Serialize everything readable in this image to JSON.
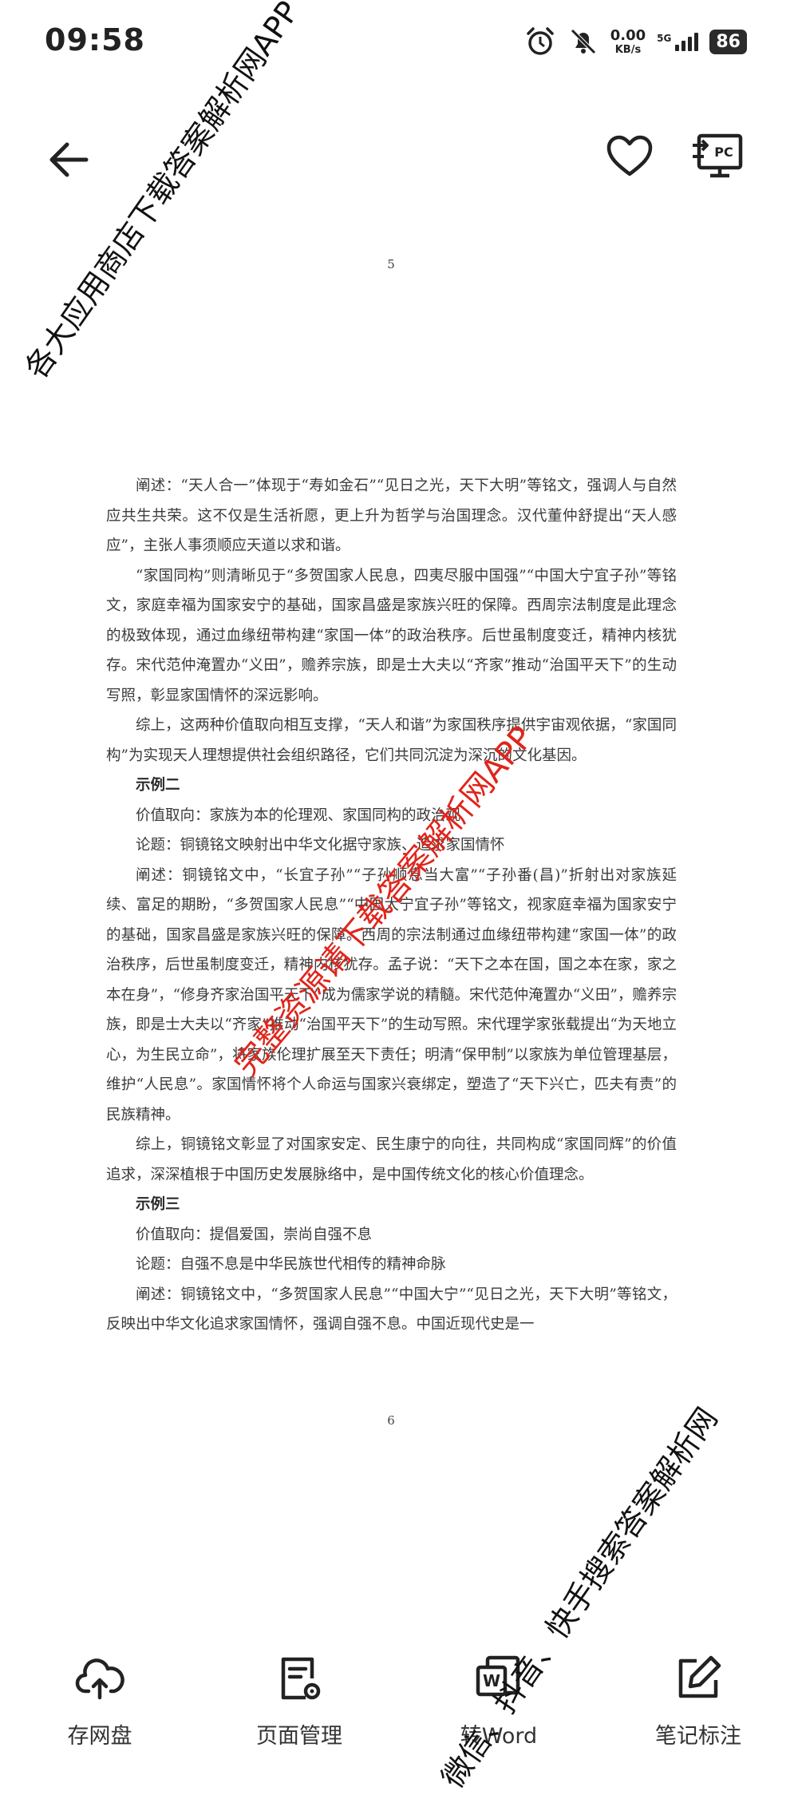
{
  "status_bar": {
    "time": "09:58",
    "net_speed_value": "0.00",
    "net_speed_unit": "KB/s",
    "network": "5G",
    "battery": "86"
  },
  "nav": {
    "back_icon": "arrow-left-icon",
    "favorite_icon": "heart-icon",
    "pc_icon": "cast-to-pc-icon",
    "pc_label": "PC"
  },
  "document": {
    "page_number_top": "5",
    "page_number_bottom": "6",
    "paragraphs": [
      {
        "type": "indent",
        "text": "阐述：“天人合一”体现于“寿如金石”“见日之光，天下大明”等铭文，强调人与自然应共生共荣。这不仅是生活祈愿，更上升为哲学与治国理念。汉代董仲舒提出“天人感应”，主张人事须顺应天道以求和谐。"
      },
      {
        "type": "indent",
        "text": "“家国同构”则清晰见于“多贺国家人民息，四夷尽服中国强”“中国大宁宜子孙”等铭文，家庭幸福为国家安宁的基础，国家昌盛是家族兴旺的保障。西周宗法制度是此理念的极致体现，通过血缘纽带构建“家国一体”的政治秩序。后世虽制度变迁，精神内核犹存。宋代范仲淹置办“义田”，赡养宗族，即是士大夫以“齐家”推动“治国平天下”的生动写照，彰显家国情怀的深远影响。"
      },
      {
        "type": "indent",
        "text": "综上，这两种价值取向相互支撑，“天人和谐”为家国秩序提供宇宙观依据，“家国同构”为实现天人理想提供社会组织路径，它们共同沉淀为深沉的文化基因。"
      },
      {
        "type": "heading",
        "text": "示例二"
      },
      {
        "type": "indent",
        "text": "价值取向：家族为本的伦理观、家国同构的政治观"
      },
      {
        "type": "indent",
        "text": "论题：铜镜铭文映射出中华文化据守家族、追求家国情怀"
      },
      {
        "type": "indent",
        "text": "阐述：铜镜铭文中，“长宜子孙”“子孙顺息当大富”“子孙番(昌)”折射出对家族延续、富足的期盼，“多贺国家人民息”“中国大宁宜子孙”等铭文，视家庭幸福为国家安宁的基础，国家昌盛是家族兴旺的保障。西周的宗法制通过血缘纽带构建“家国一体”的政治秩序，后世虽制度变迁，精神内核犹存。孟子说：“天下之本在国，国之本在家，家之本在身”，“修身齐家治国平天下”成为儒家学说的精髓。宋代范仲淹置办“义田”，赡养宗族，即是士大夫以“齐家”推动“治国平天下”的生动写照。宋代理学家张载提出“为天地立心，为生民立命”，将家族伦理扩展至天下责任；明清“保甲制”以家族为单位管理基层，维护“人民息”。家国情怀将个人命运与国家兴衰绑定，塑造了“天下兴亡，匹夫有责”的民族精神。"
      },
      {
        "type": "indent",
        "text": "综上，铜镜铭文彰显了对国家安定、民生康宁的向往，共同构成“家国同辉”的价值追求，深深植根于中国历史发展脉络中，是中国传统文化的核心价值理念。"
      },
      {
        "type": "heading",
        "text": "示例三"
      },
      {
        "type": "indent",
        "text": "价值取向：提倡爱国，崇尚自强不息"
      },
      {
        "type": "indent",
        "text": "论题：自强不息是中华民族世代相传的精神命脉"
      },
      {
        "type": "indent",
        "text": "阐述：铜镜铭文中，“多贺国家人民息”“中国大宁”“见日之光，天下大明”等铭文，反映出中华文化追求家国情怀，强调自强不息。中国近现代史是一"
      }
    ]
  },
  "toolbar": {
    "items": [
      {
        "icon": "cloud-upload-icon",
        "label": "存网盘"
      },
      {
        "icon": "page-settings-icon",
        "label": "页面管理"
      },
      {
        "icon": "word-convert-icon",
        "label": "转Word"
      },
      {
        "icon": "edit-note-icon",
        "label": "笔记标注"
      }
    ]
  },
  "watermarks": {
    "top_left": "各大应用商店下载答案解析网APP",
    "center": "完整资源请下载答案解析网APP",
    "bottom_right": "微信、抖音、快手搜索答案解析网"
  }
}
